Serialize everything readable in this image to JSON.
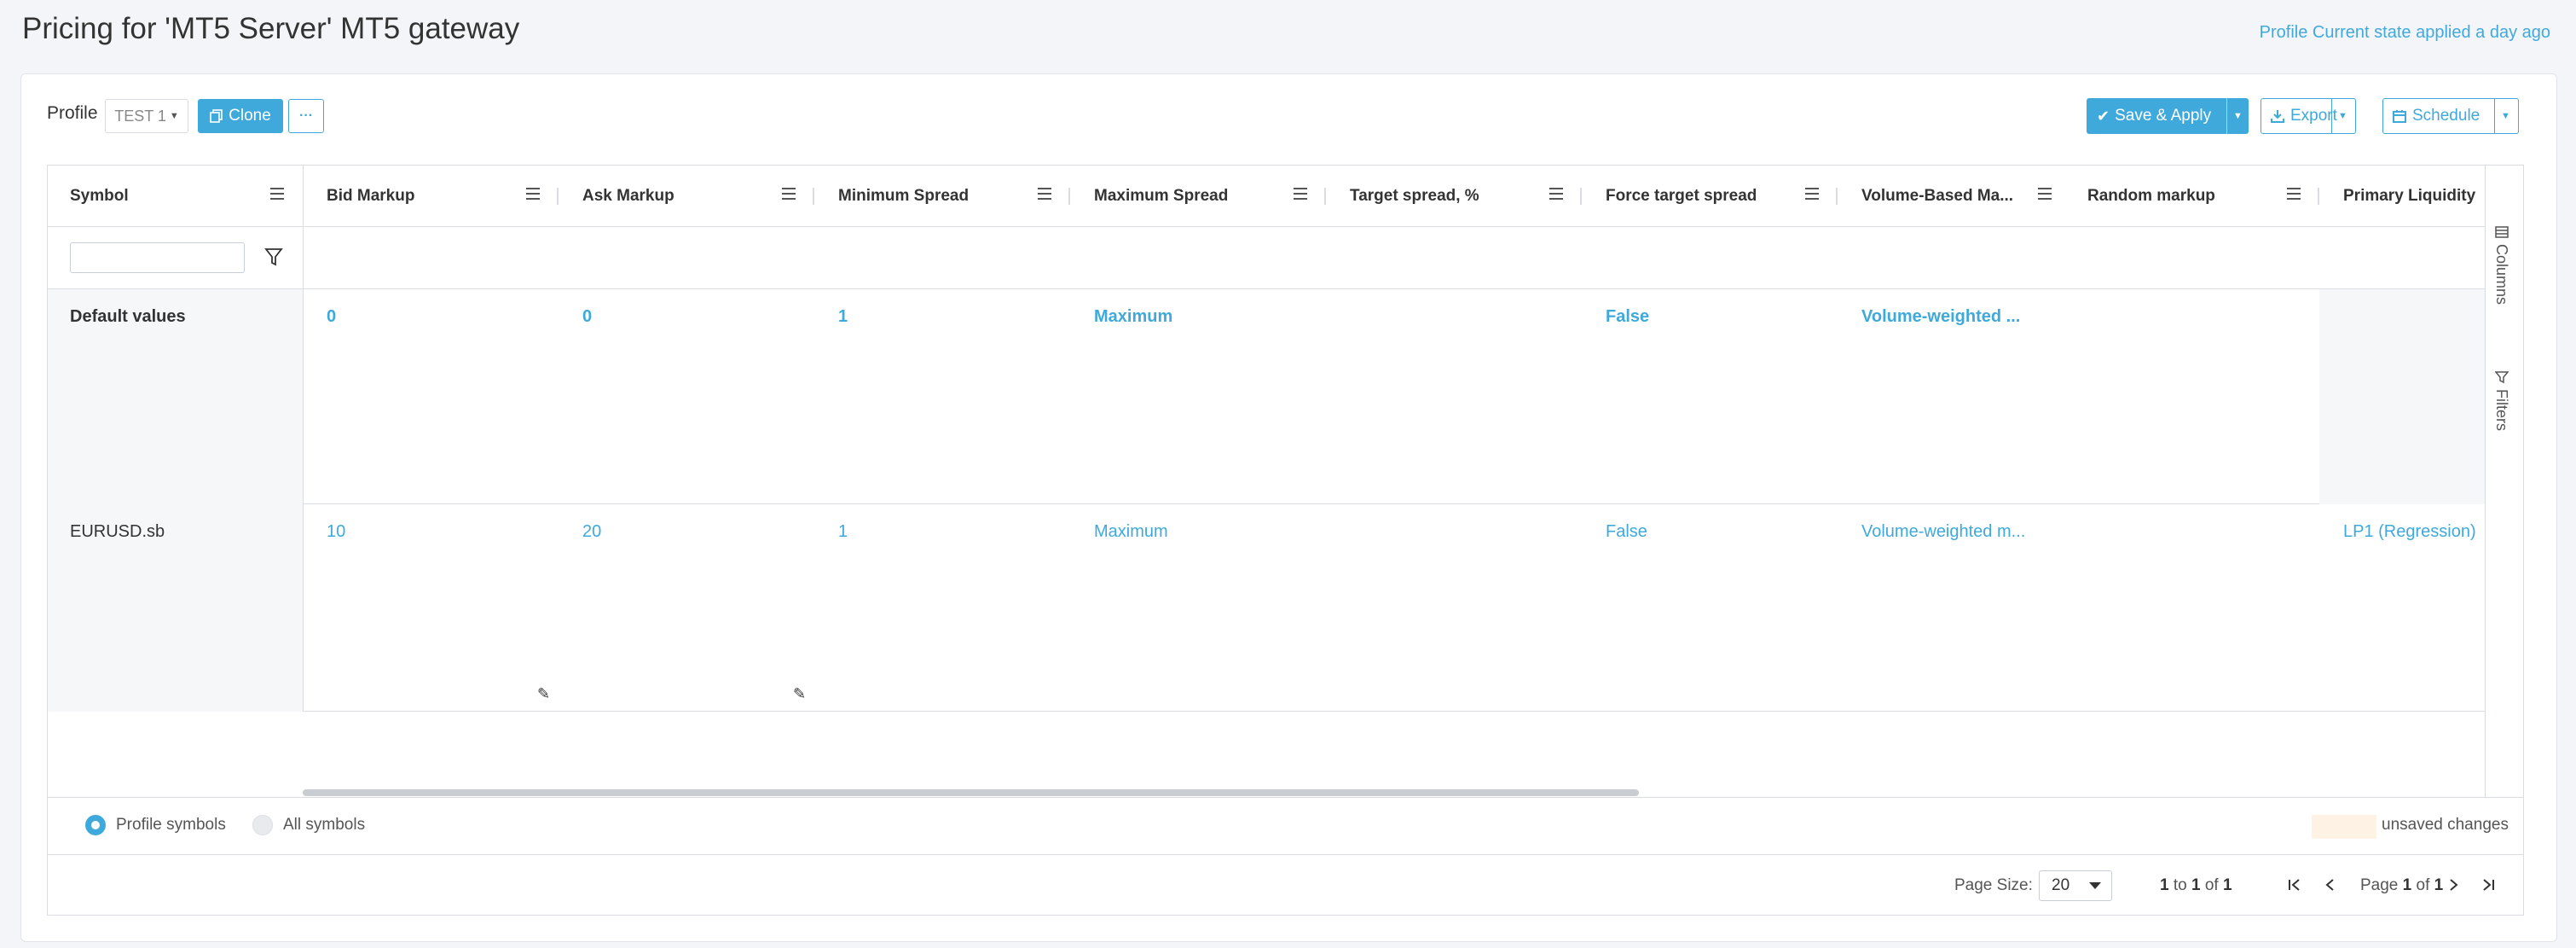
{
  "header": {
    "title": "Pricing for 'MT5 Server' MT5 gateway",
    "status": "Profile Current state applied a day ago"
  },
  "toolbar": {
    "profile_label": "Profile",
    "profile_value": "TEST 1",
    "clone_label": "Clone",
    "more_label": "···",
    "save_apply_label": "Save & Apply",
    "export_label": "Export",
    "schedule_label": "Schedule"
  },
  "grid": {
    "columns": [
      "Symbol",
      "Bid Markup",
      "Ask Markup",
      "Minimum Spread",
      "Maximum Spread",
      "Target spread, %",
      "Force target spread",
      "Volume-Based Ma...",
      "Random markup",
      "Primary Liquidity"
    ],
    "default_row": {
      "symbol": "Default values",
      "bid_markup": "0",
      "ask_markup": "0",
      "min_spread": "1",
      "max_spread": "Maximum",
      "force_target_spread": "False",
      "volume_based": "Volume-weighted ..."
    },
    "rows": [
      {
        "symbol": "EURUSD.sb",
        "bid_markup": "10",
        "ask_markup": "20",
        "min_spread": "1",
        "max_spread": "Maximum",
        "force_target_spread": "False",
        "volume_based": "Volume-weighted m...",
        "primary_liquidity": "LP1 (Regression)"
      }
    ],
    "side_panel": {
      "columns_label": "Columns",
      "filters_label": "Filters"
    }
  },
  "footer": {
    "profile_symbols_label": "Profile symbols",
    "all_symbols_label": "All symbols",
    "unsaved_label": "unsaved changes",
    "page_size_label": "Page Size:",
    "page_size_value": "20",
    "range": {
      "from": "1",
      "to_word": "to",
      "to": "1",
      "of_word": "of",
      "total": "1"
    },
    "page": {
      "page_word": "Page",
      "current": "1",
      "of_word": "of",
      "total": "1"
    }
  },
  "colors": {
    "accent": "#3fa9dc",
    "unsaved": "#fdf2e4",
    "pinned_bg": "#f6f7f9"
  }
}
